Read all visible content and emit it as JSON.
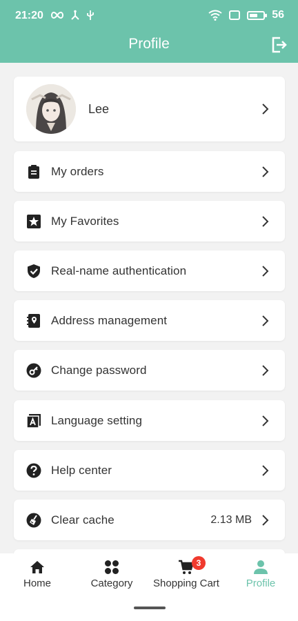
{
  "status_bar": {
    "time": "21:20",
    "battery": "56"
  },
  "header": {
    "title": "Profile"
  },
  "profile": {
    "name": "Lee"
  },
  "menu": [
    {
      "label": "My orders",
      "icon": "clipboard-icon"
    },
    {
      "label": "My Favorites",
      "icon": "star-icon"
    },
    {
      "label": "Real-name authentication",
      "icon": "shield-icon"
    },
    {
      "label": "Address management",
      "icon": "address-book-icon"
    },
    {
      "label": "Change password",
      "icon": "key-icon"
    },
    {
      "label": "Language setting",
      "icon": "language-icon"
    },
    {
      "label": "Help center",
      "icon": "help-icon"
    },
    {
      "label": "Clear cache",
      "icon": "broom-icon",
      "value": "2.13 MB"
    }
  ],
  "bottom_nav": [
    {
      "label": "Home",
      "icon": "home-icon"
    },
    {
      "label": "Category",
      "icon": "category-icon"
    },
    {
      "label": "Shopping Cart",
      "icon": "cart-icon",
      "badge": "3"
    },
    {
      "label": "Profile",
      "icon": "user-icon",
      "active": true
    }
  ],
  "colors": {
    "accent": "#6cc3ab",
    "badge": "#f03a2e"
  }
}
